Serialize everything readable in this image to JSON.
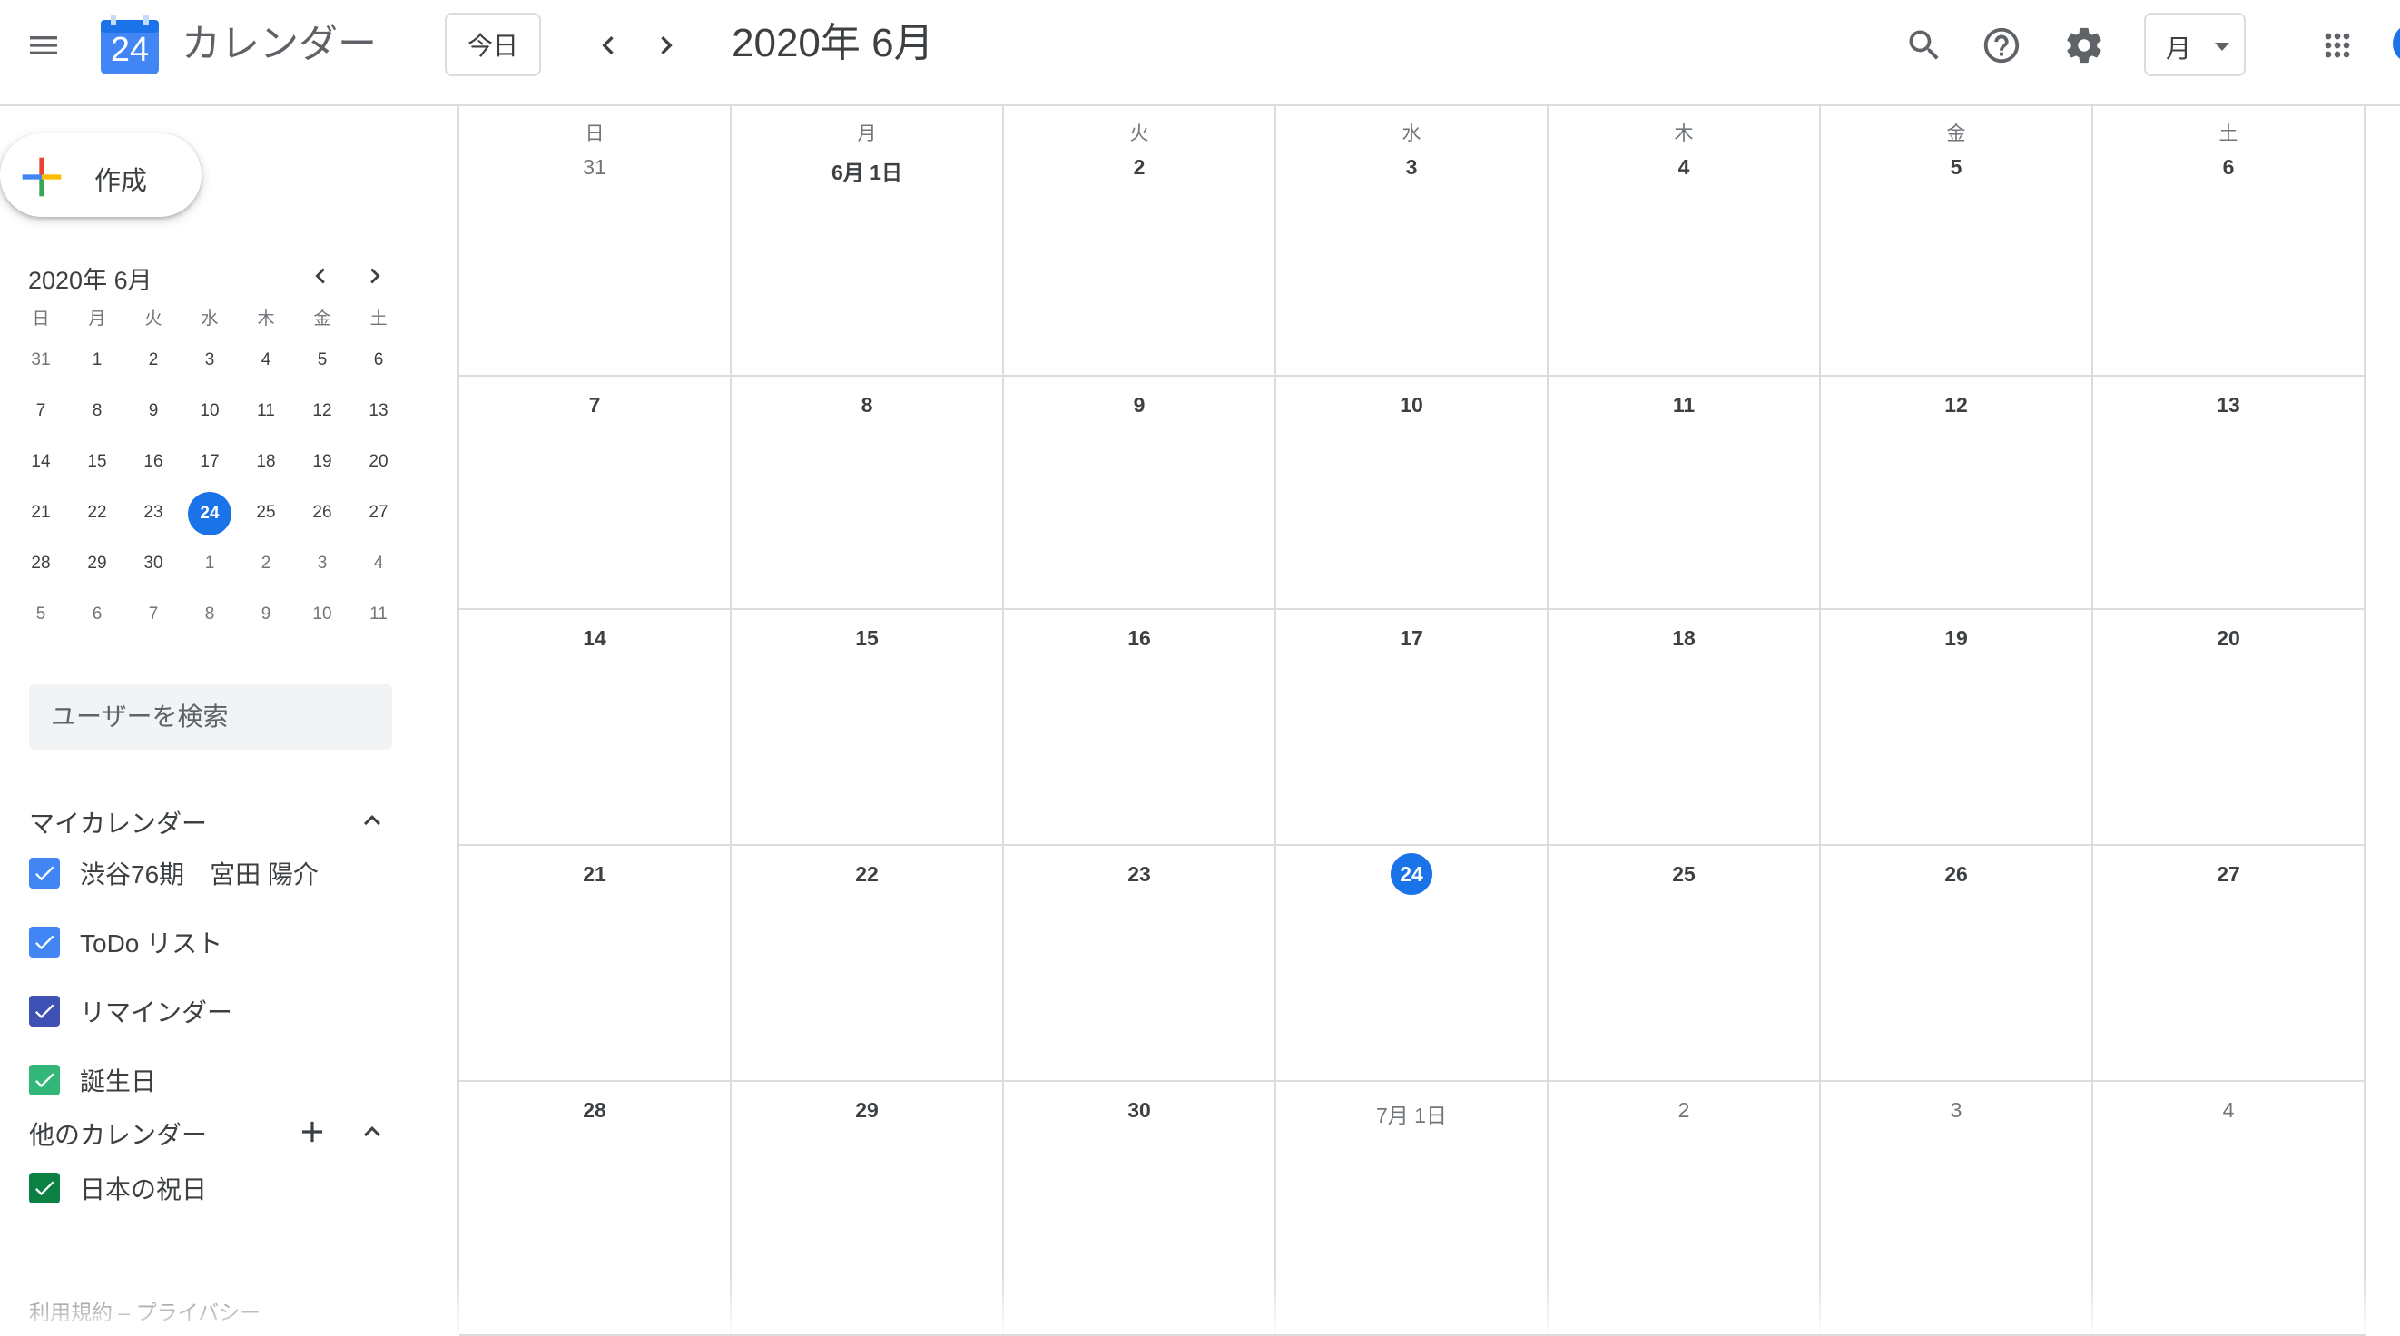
{
  "header": {
    "app_title": "カレンダー",
    "logo_day": "24",
    "today_button": "今日",
    "current_period": "2020年 6月",
    "view_selector": "月",
    "icons": [
      "menu-icon",
      "search-icon",
      "help-icon",
      "settings-icon",
      "apps-grid-icon",
      "chevron-left-icon",
      "chevron-right-icon"
    ]
  },
  "sidebar": {
    "create_button": "作成",
    "mini_calendar": {
      "title": "2020年 6月",
      "weekdays": [
        "日",
        "月",
        "火",
        "水",
        "木",
        "金",
        "土"
      ],
      "weeks": [
        [
          "31",
          "1",
          "2",
          "3",
          "4",
          "5",
          "6"
        ],
        [
          "7",
          "8",
          "9",
          "10",
          "11",
          "12",
          "13"
        ],
        [
          "14",
          "15",
          "16",
          "17",
          "18",
          "19",
          "20"
        ],
        [
          "21",
          "22",
          "23",
          "24",
          "25",
          "26",
          "27"
        ],
        [
          "28",
          "29",
          "30",
          "1",
          "2",
          "3",
          "4"
        ],
        [
          "5",
          "6",
          "7",
          "8",
          "9",
          "10",
          "11"
        ]
      ]
    },
    "user_search_placeholder": "ユーザーを検索",
    "my_calendars": {
      "title": "マイカレンダー",
      "items": [
        {
          "label": "渋谷76期　宮田 陽介",
          "color": "#4285f4",
          "checked": true
        },
        {
          "label": "ToDo リスト",
          "color": "#4285f4",
          "checked": true
        },
        {
          "label": "リマインダー",
          "color": "#3f51b5",
          "checked": true
        },
        {
          "label": "誕生日",
          "color": "#33b679",
          "checked": true
        }
      ]
    },
    "other_calendars": {
      "title": "他のカレンダー",
      "items": [
        {
          "label": "日本の祝日",
          "color": "#0b8043",
          "checked": true
        }
      ]
    },
    "footer": "利用規約 – プライバシー"
  },
  "month_grid": {
    "weekdays": [
      "日",
      "月",
      "火",
      "水",
      "木",
      "金",
      "土"
    ],
    "weeks": [
      [
        "31",
        "6月 1日",
        "2",
        "3",
        "4",
        "5",
        "6"
      ],
      [
        "7",
        "8",
        "9",
        "10",
        "11",
        "12",
        "13"
      ],
      [
        "14",
        "15",
        "16",
        "17",
        "18",
        "19",
        "20"
      ],
      [
        "21",
        "22",
        "23",
        "24",
        "25",
        "26",
        "27"
      ],
      [
        "28",
        "29",
        "30",
        "7月 1日",
        "2",
        "3",
        "4"
      ]
    ],
    "today": "24"
  },
  "colors": {
    "accent": "#1a73e8",
    "grid_line": "#dadce0"
  }
}
